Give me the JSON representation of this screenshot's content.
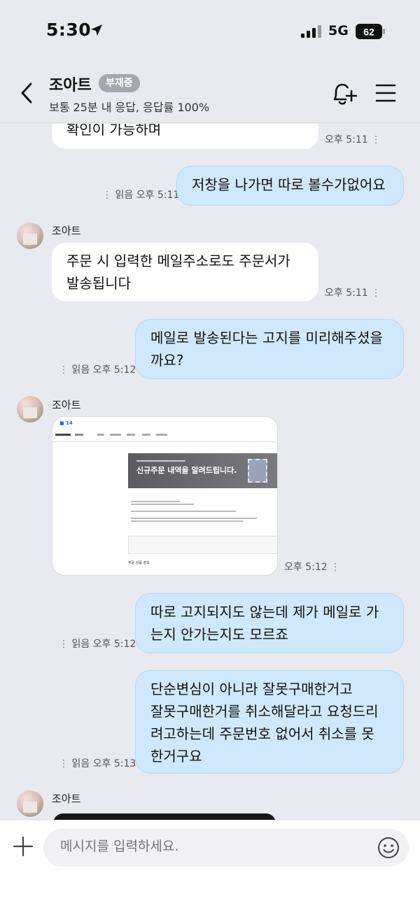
{
  "status": {
    "time": "5:30",
    "network": "5G",
    "battery": "62"
  },
  "header": {
    "shop_name": "조아트",
    "away_badge": "부재중",
    "response_info": "보통 25분 내 응답, 응답률 100%"
  },
  "messages": [
    {
      "type": "received",
      "text": "확인이 가능하며",
      "time": "오후 5:11"
    },
    {
      "type": "sent",
      "text": "저창을 나가면 따로 볼수가없어요",
      "read": "읽음",
      "time": "오후 5:11"
    },
    {
      "type": "received",
      "sender": "조아트",
      "lines": [
        "주문 시 입력한 메일주소로도 주문서가",
        "발송됩니다"
      ],
      "time": "오후 5:11"
    },
    {
      "type": "sent",
      "lines": [
        "메일로 발송된다는 고지를 미리해주셨을",
        "까요?"
      ],
      "read": "읽음",
      "time": "오후 5:12"
    },
    {
      "type": "received_image",
      "sender": "조아트",
      "time": "오후 5:12",
      "image": {
        "banner_title": "신규주문 내역을 알려드립니다.",
        "section": "주문 상품 정보"
      }
    },
    {
      "type": "sent",
      "lines": [
        "따로 고지되지도 않는데 제가 메일로 가",
        "는지 안가는지도 모르죠"
      ],
      "read": "읽음",
      "time": "오후 5:12"
    },
    {
      "type": "sent",
      "lines": [
        "단순변심이 아니라 잘못구매한거고",
        "잘못구매한거를 취소해달라고 요청드리",
        "려고하는데 주문번호 없어서 취소를 못",
        "한거구요"
      ],
      "read": "읽음",
      "time": "오후 5:13"
    },
    {
      "type": "received_partial",
      "sender": "조아트"
    }
  ],
  "input": {
    "placeholder": "메시지를 입력하세요."
  },
  "colors": {
    "sent_bubble": "#cfe8fb",
    "received_bubble": "#ffffff",
    "background": "#e9e9f0",
    "away_badge": "#a4a7ae"
  }
}
